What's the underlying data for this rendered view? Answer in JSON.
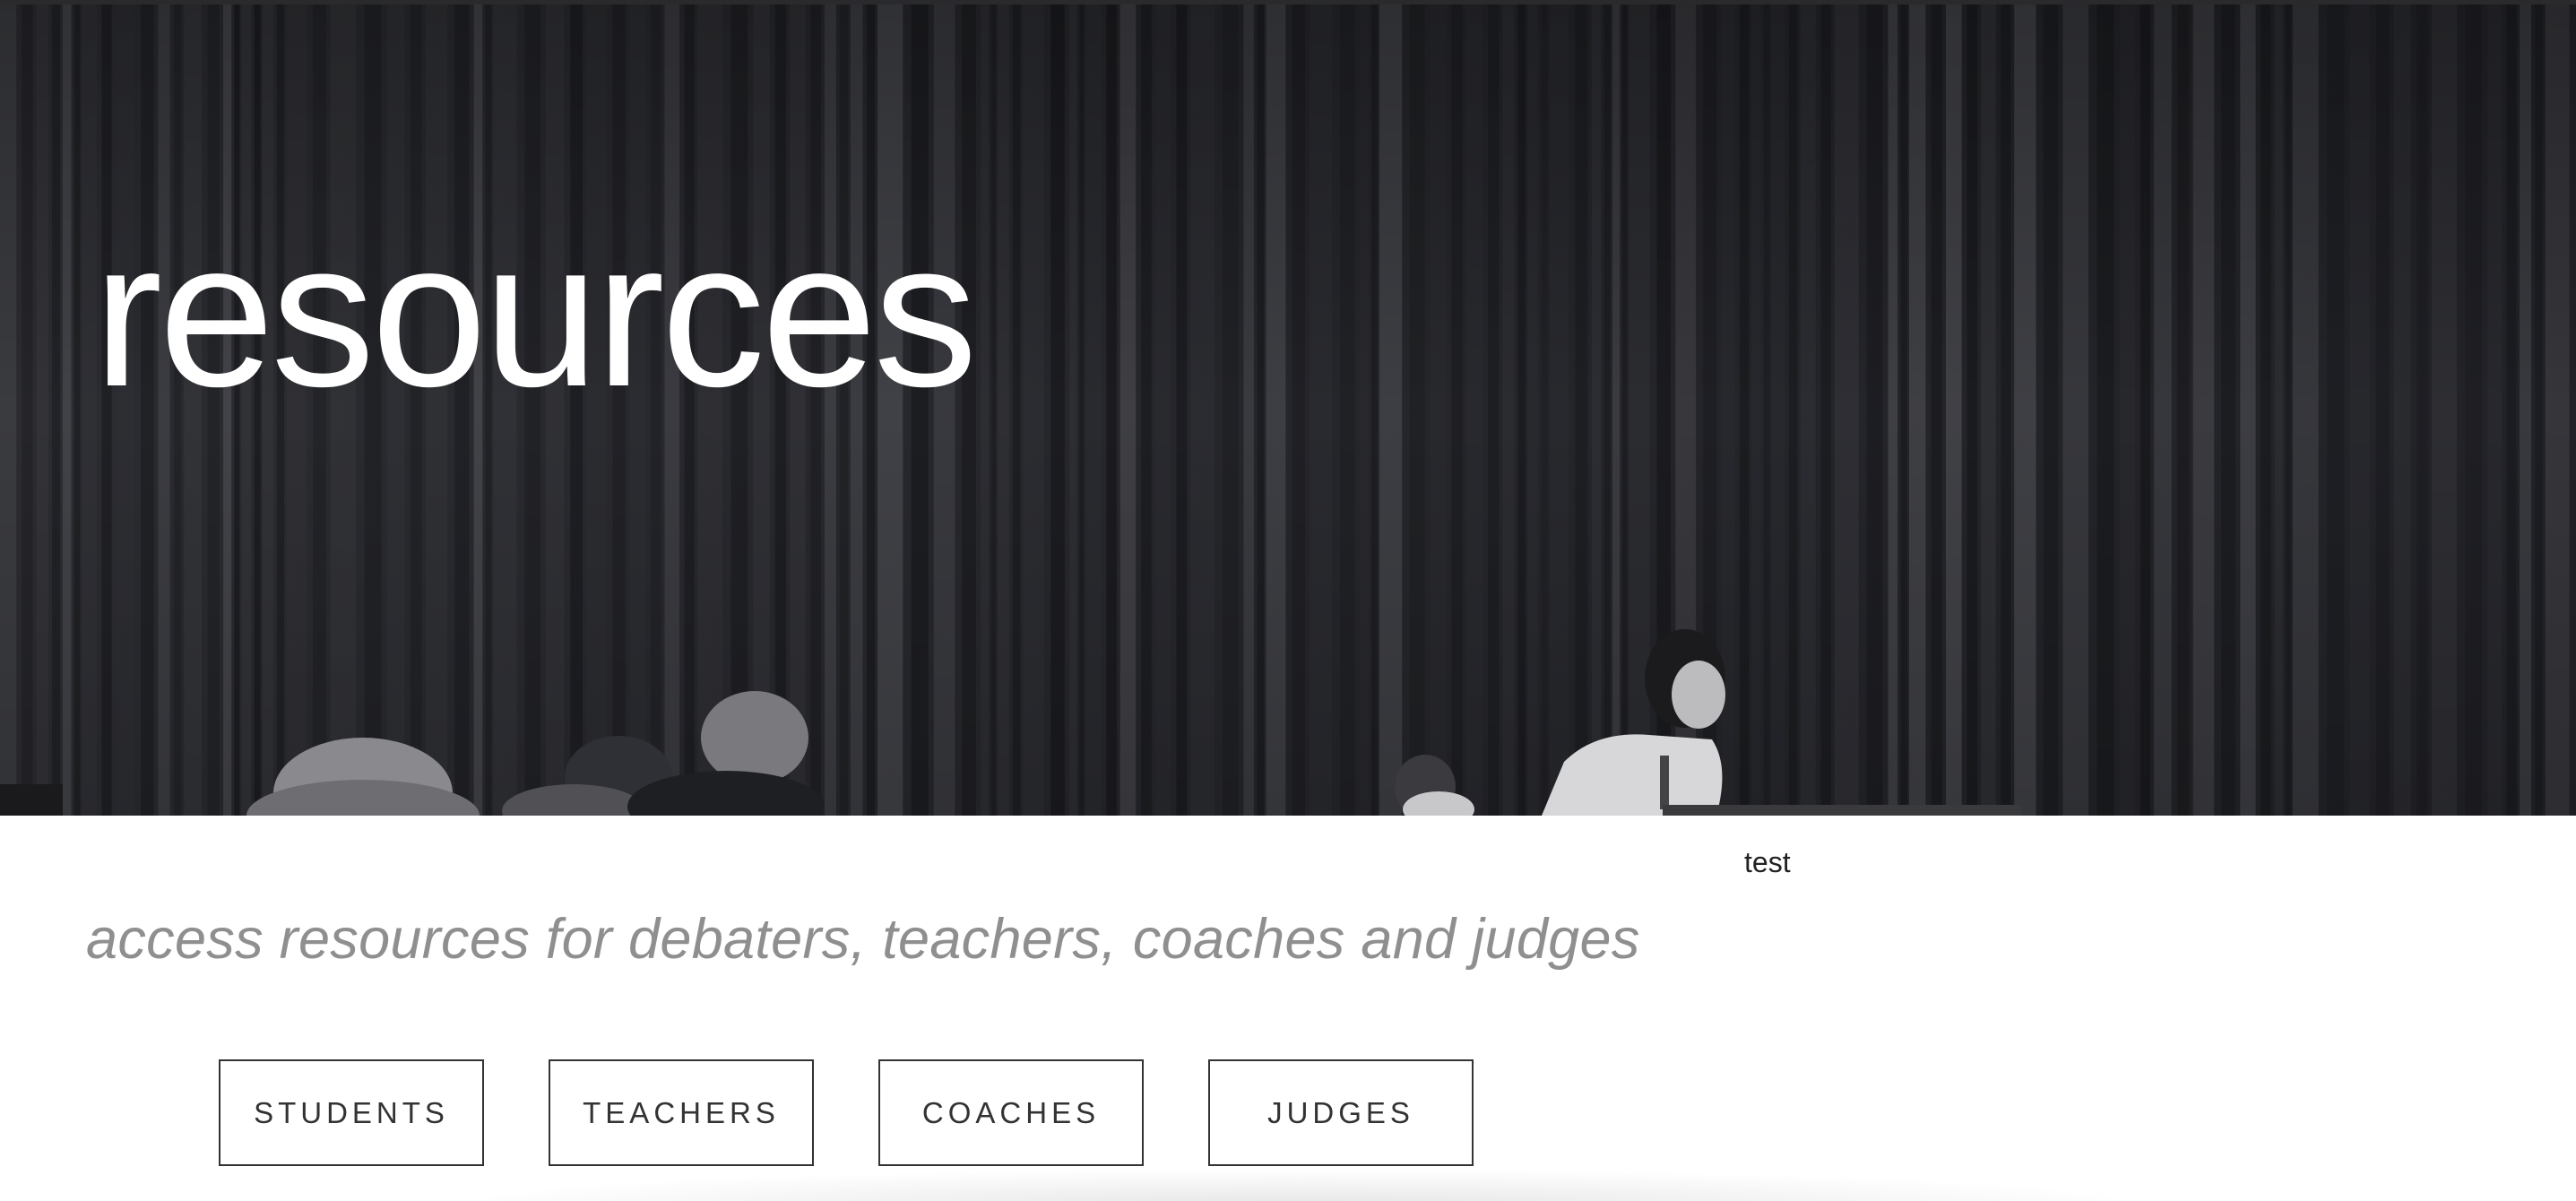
{
  "hero": {
    "title": "resources"
  },
  "test_label": "test",
  "tagline": "access resources for debaters, teachers, coaches and judges",
  "buttons": {
    "students": "STUDENTS",
    "teachers": "TEACHERS",
    "coaches": "COACHES",
    "judges": "JUDGES"
  },
  "colors": {
    "hero_background": "#26272c",
    "hero_text": "#ffffff",
    "tagline_text": "#8f8f8f",
    "button_border": "#333333",
    "button_text": "#333333"
  }
}
